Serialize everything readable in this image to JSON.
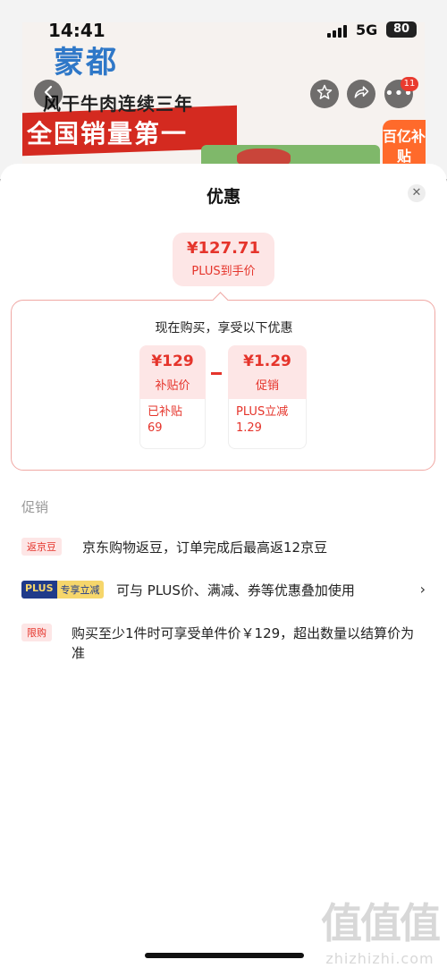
{
  "status_bar": {
    "time": "14:41",
    "network": "5G",
    "battery": "80"
  },
  "background_page": {
    "brand_logo": "蒙都",
    "slogan_line1": "风干牛肉连续三年",
    "slogan_line2": "全国销量第一",
    "subsidy_badge": "百亿补贴",
    "message_count": "11"
  },
  "sheet": {
    "title": "优惠",
    "final_price": "¥127.71",
    "final_price_label": "PLUS到手价",
    "calc_heading": "现在购买，享受以下优惠",
    "cards": [
      {
        "price": "¥129",
        "label": "补贴价",
        "detail": "已补贴\n69"
      },
      {
        "price": "¥1.29",
        "label": "促销",
        "detail": "PLUS立减\n1.29"
      }
    ],
    "promo_section_title": "促销",
    "promotions": [
      {
        "tag": "返京豆",
        "text": "京东购物返豆，订单完成后最高返12京豆"
      },
      {
        "tag_plus": "PLUS",
        "tag_plus_extra": "专享立减",
        "text": "可与 PLUS价、满减、券等优惠叠加使用"
      },
      {
        "tag": "限购",
        "text": "购买至少1件时可享受单件价￥129，超出数量以结算价为准"
      }
    ]
  },
  "watermark": {
    "logo": "值值值",
    "site": "zhizhizhi.com"
  },
  "icons": [
    "back-icon",
    "star-icon",
    "share-icon",
    "more-icon",
    "close-icon",
    "chevron-right-icon"
  ]
}
